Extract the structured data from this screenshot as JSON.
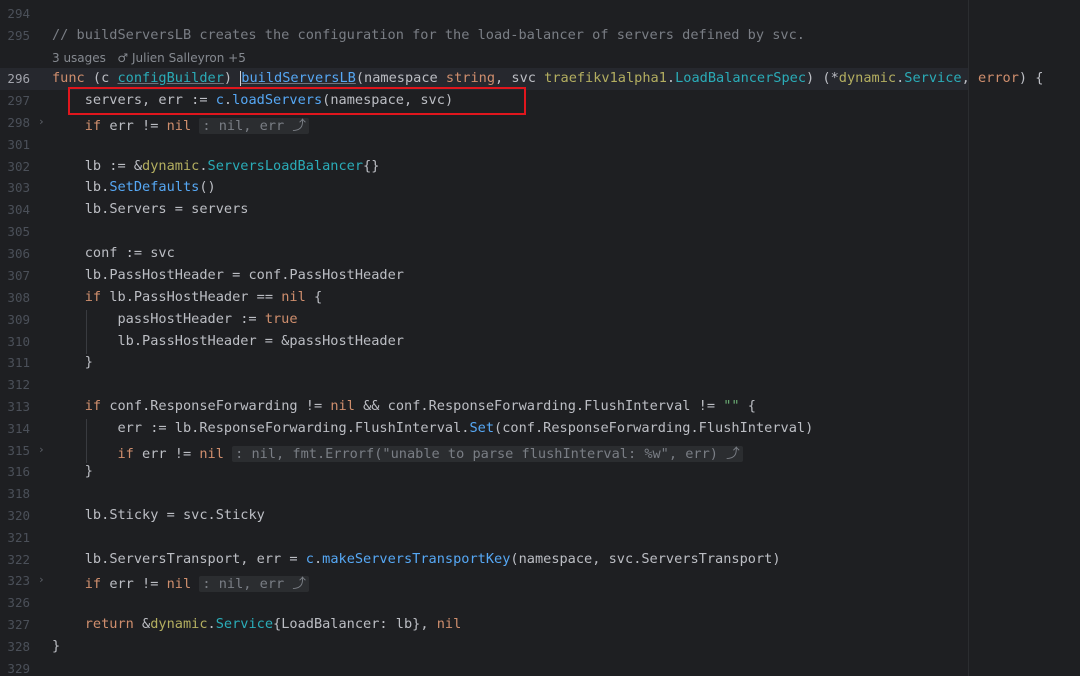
{
  "lines": [
    {
      "no": "294",
      "code": ""
    },
    {
      "no": "295",
      "code": "// buildServersLB creates the configuration for the load-balancer of servers defined by svc."
    },
    {
      "no": "296",
      "code": "func (c configBuilder) buildServersLB(namespace string, svc traefikv1alpha1.LoadBalancerSpec) (*dynamic.Service, error) {"
    },
    {
      "no": "297",
      "code": "    servers, err := c.loadServers(namespace, svc)"
    },
    {
      "no": "298",
      "code": "    if err != nil : nil, err"
    },
    {
      "no": "301",
      "code": ""
    },
    {
      "no": "302",
      "code": "    lb := &dynamic.ServersLoadBalancer{}"
    },
    {
      "no": "303",
      "code": "    lb.SetDefaults()"
    },
    {
      "no": "304",
      "code": "    lb.Servers = servers"
    },
    {
      "no": "305",
      "code": ""
    },
    {
      "no": "306",
      "code": "    conf := svc"
    },
    {
      "no": "307",
      "code": "    lb.PassHostHeader = conf.PassHostHeader"
    },
    {
      "no": "308",
      "code": "    if lb.PassHostHeader == nil {"
    },
    {
      "no": "309",
      "code": "        passHostHeader := true"
    },
    {
      "no": "310",
      "code": "        lb.PassHostHeader = &passHostHeader"
    },
    {
      "no": "311",
      "code": "    }"
    },
    {
      "no": "312",
      "code": ""
    },
    {
      "no": "313",
      "code": "    if conf.ResponseForwarding != nil && conf.ResponseForwarding.FlushInterval != \"\" {"
    },
    {
      "no": "314",
      "code": "        err := lb.ResponseForwarding.FlushInterval.Set(conf.ResponseForwarding.FlushInterval)"
    },
    {
      "no": "315",
      "code": "        if err != nil : nil, fmt.Errorf(\"unable to parse flushInterval: %w\", err)"
    },
    {
      "no": "316",
      "code": "    }"
    },
    {
      "no": "318",
      "code": ""
    },
    {
      "no": "320",
      "code": "    lb.Sticky = svc.Sticky"
    },
    {
      "no": "321",
      "code": ""
    },
    {
      "no": "322",
      "code": "    lb.ServersTransport, err = c.makeServersTransportKey(namespace, svc.ServersTransport)"
    },
    {
      "no": "323",
      "code": "    if err != nil : nil, err"
    },
    {
      "no": "326",
      "code": ""
    },
    {
      "no": "327",
      "code": "    return &dynamic.Service{LoadBalancer: lb}, nil"
    },
    {
      "no": "328",
      "code": "}"
    },
    {
      "no": "329",
      "code": ""
    }
  ],
  "usages": {
    "count_label": "3 usages",
    "author_label": "Julien Salleyron +5",
    "author_icon": "person-icon"
  },
  "fold_icon": "chevron-right-icon",
  "return_hint_icon": "return-arrow-icon",
  "highlight_line": "297",
  "current_line": "296",
  "colors": {
    "background": "#1e1f22",
    "keyword": "#cf8e6d",
    "function": "#56a8f5",
    "package": "#b3ae60",
    "type": "#2aacb8",
    "string": "#6aab73",
    "comment": "#7a7e85",
    "highlight_box": "#e0161d"
  }
}
